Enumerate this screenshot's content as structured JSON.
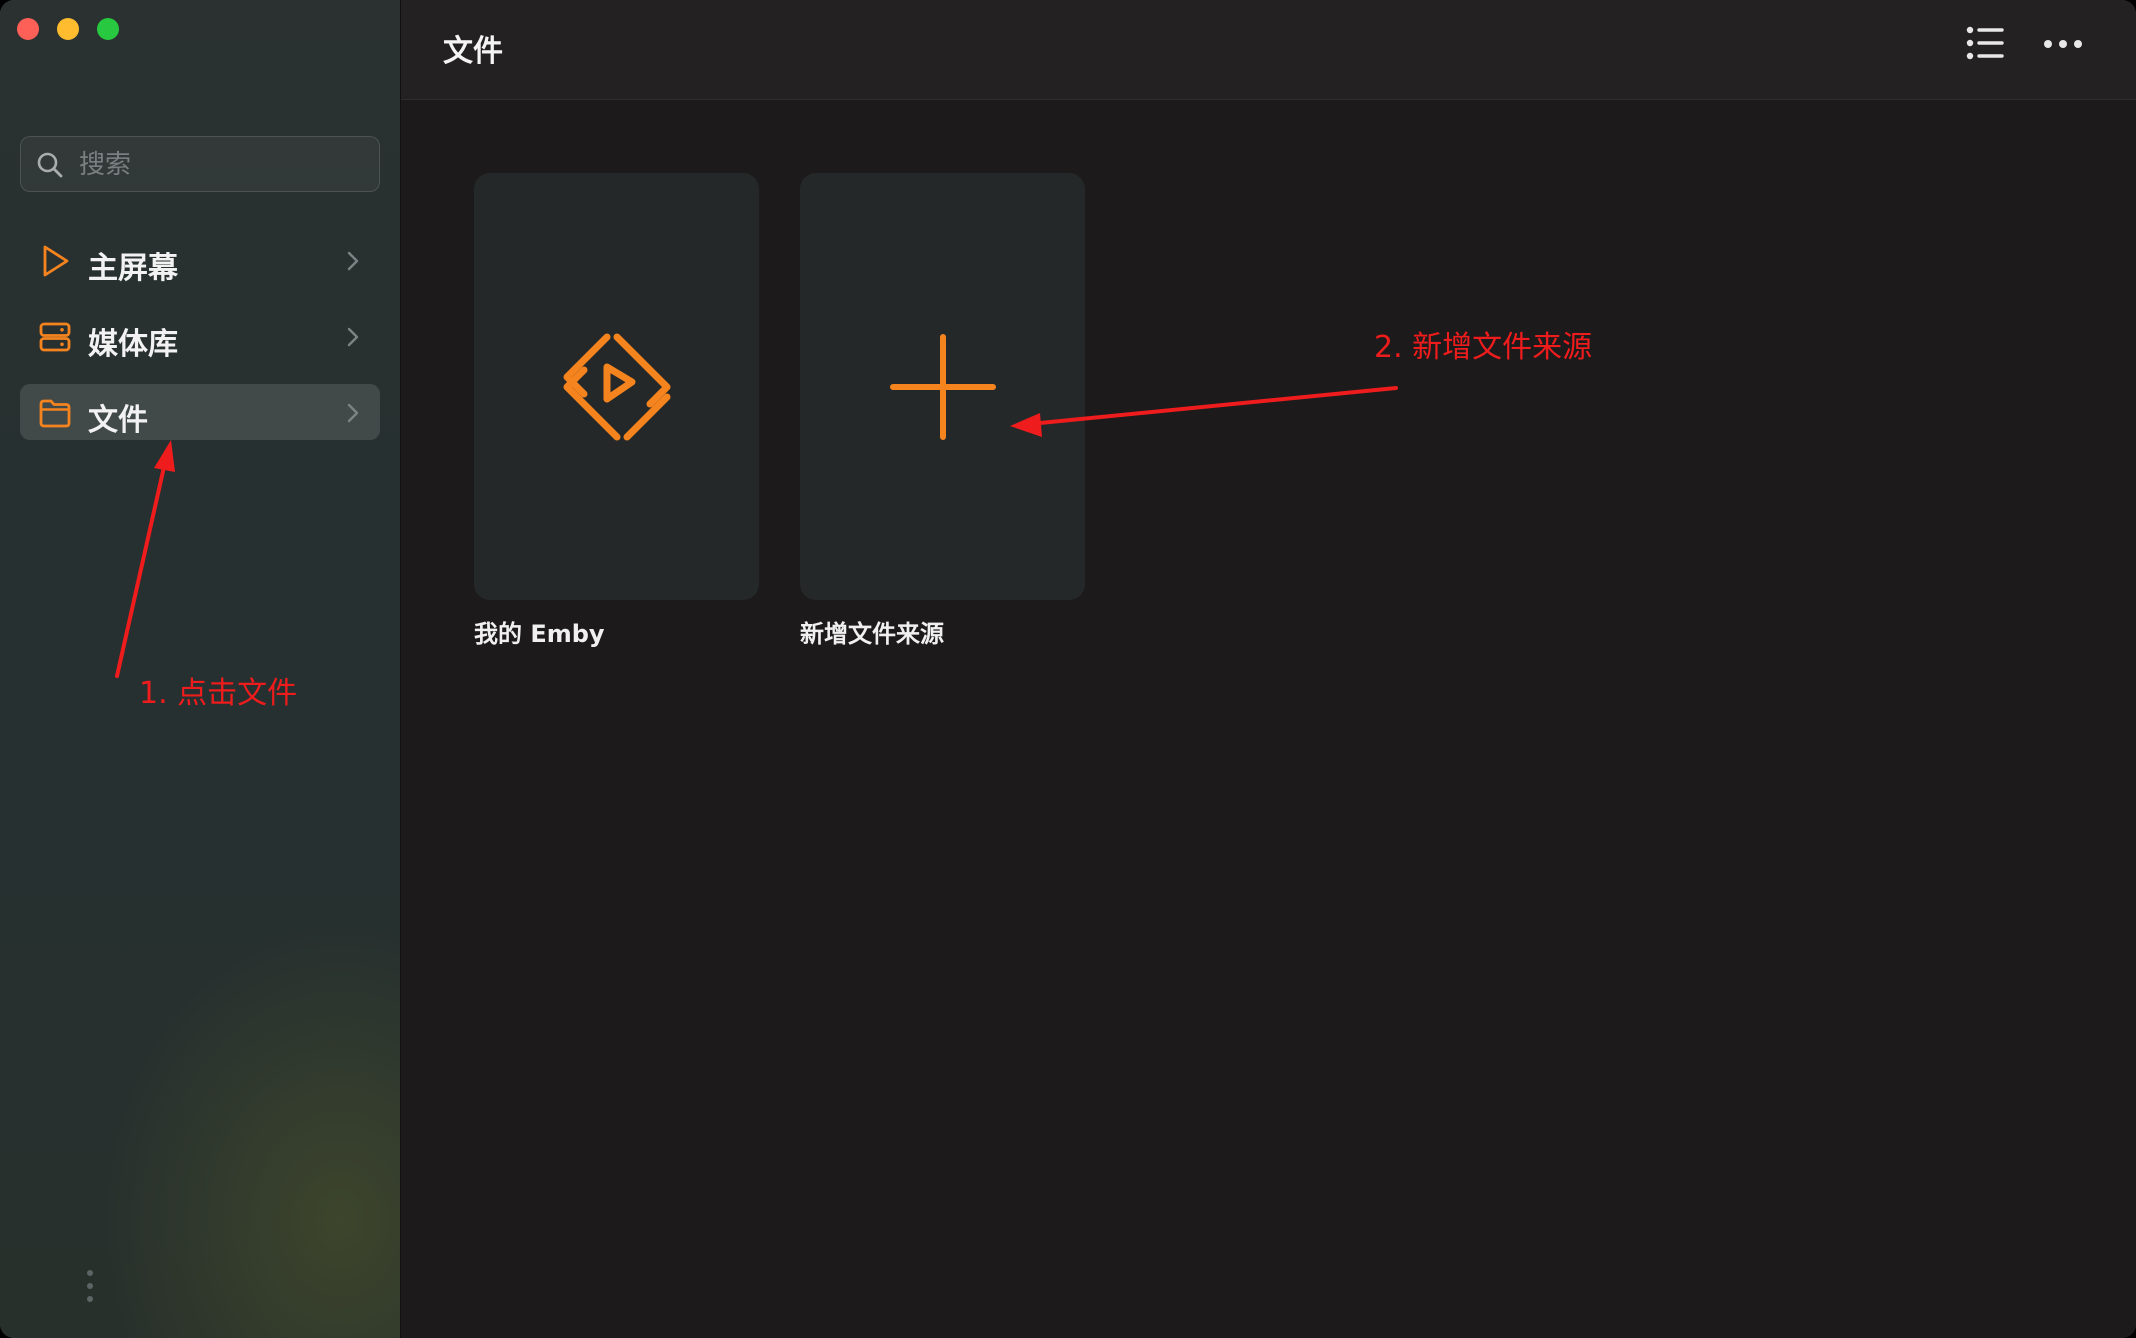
{
  "window": {
    "traffic_lights": {
      "close_color": "#fe5f57",
      "minimize_color": "#febc2e",
      "maximize_color": "#28c840"
    }
  },
  "sidebar": {
    "search": {
      "placeholder": "搜索",
      "value": "",
      "icon": "search-icon"
    },
    "items": [
      {
        "label": "主屏幕",
        "icon": "play-triangle-icon",
        "active": false
      },
      {
        "label": "媒体库",
        "icon": "server-stack-icon",
        "active": false
      },
      {
        "label": "文件",
        "icon": "folder-icon",
        "active": true
      }
    ]
  },
  "main": {
    "title": "文件",
    "toolbar_icons": [
      "list-view-icon",
      "more-options-icon"
    ],
    "tiles": [
      {
        "label": "我的 Emby",
        "icon": "emby-logo-icon"
      },
      {
        "label": "新增文件来源",
        "icon": "plus-icon"
      }
    ]
  },
  "annotations": {
    "step1": "1. 点击文件",
    "step2": "2. 新增文件来源"
  },
  "colors": {
    "accent": "#f5841f",
    "annotation": "#ee1c1c",
    "sidebar_bg": "#283030",
    "main_bg": "#1c1a1b",
    "tile_bg": "#252828"
  }
}
